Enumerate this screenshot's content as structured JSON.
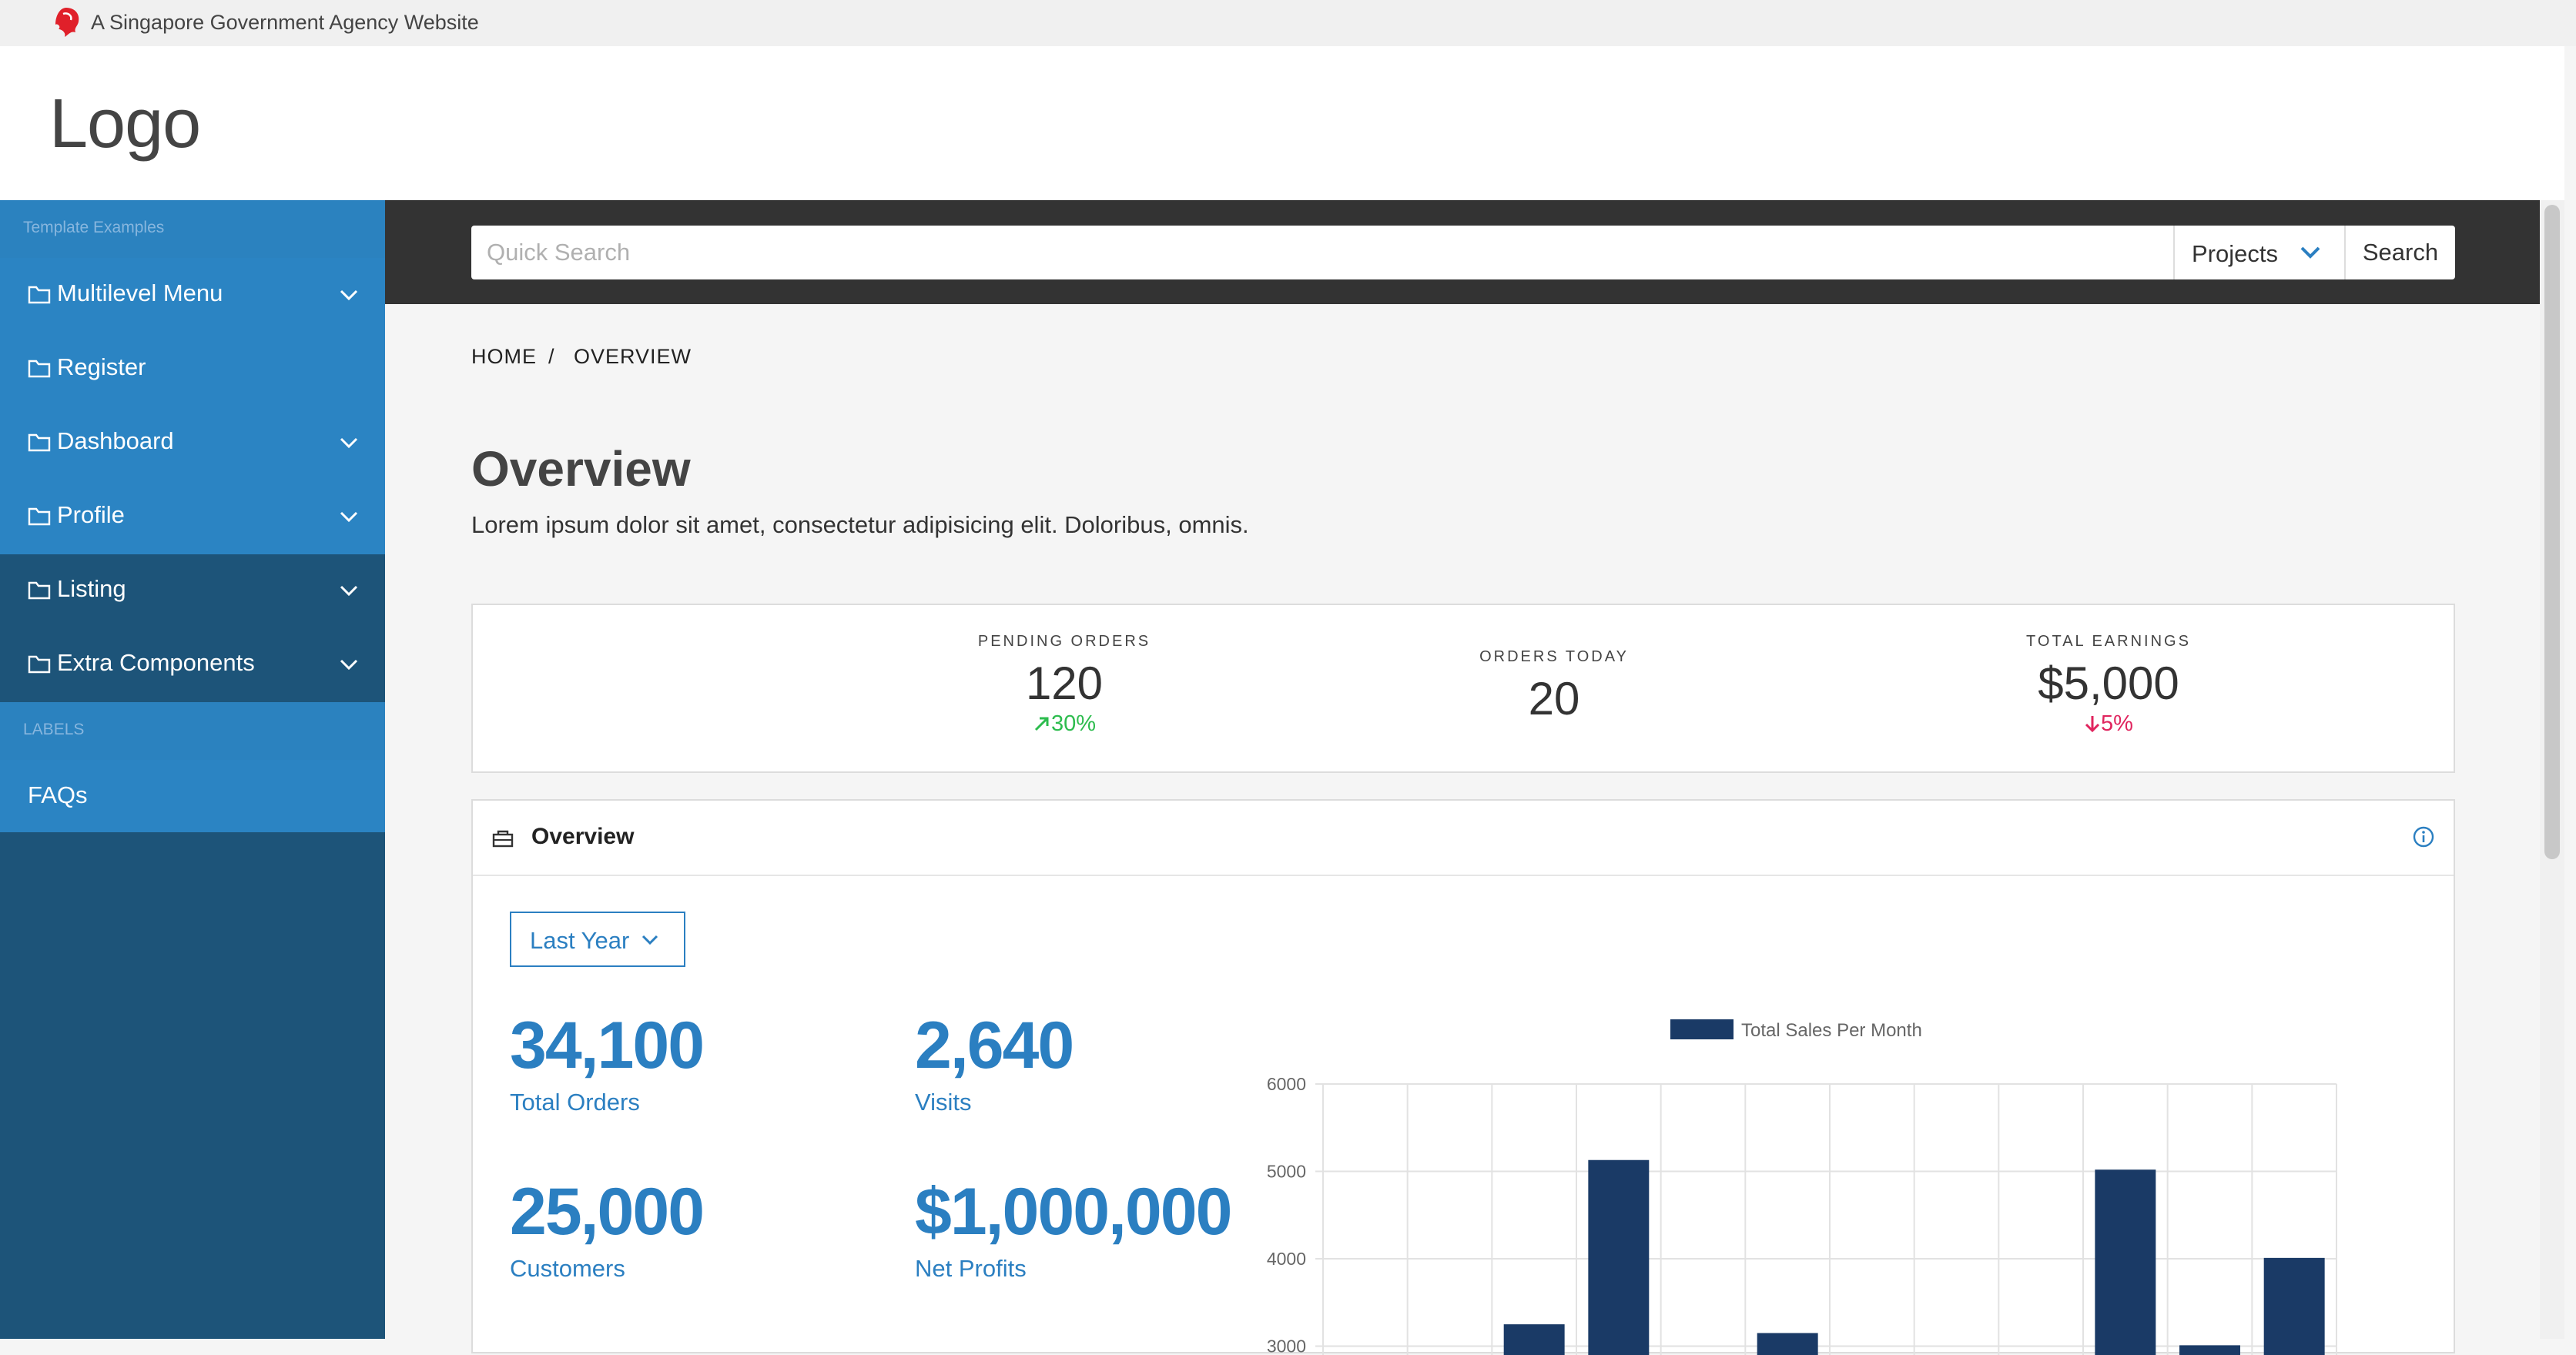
{
  "masthead": {
    "text": "A Singapore Government Agency Website"
  },
  "header": {
    "logo": "Logo"
  },
  "sidebar": {
    "section1": "Template Examples",
    "items": [
      {
        "label": "Multilevel Menu",
        "expandable": true
      },
      {
        "label": "Register",
        "expandable": false
      },
      {
        "label": "Dashboard",
        "expandable": true
      },
      {
        "label": "Profile",
        "expandable": true
      },
      {
        "label": "Listing",
        "expandable": true
      },
      {
        "label": "Extra Components",
        "expandable": true
      }
    ],
    "section2": "LABELS",
    "faq": "FAQs"
  },
  "search": {
    "placeholder": "Quick Search",
    "category": "Projects",
    "button": "Search"
  },
  "breadcrumb": {
    "home": "HOME",
    "sep": "/",
    "current": "OVERVIEW"
  },
  "page": {
    "title": "Overview",
    "subtitle": "Lorem ipsum dolor sit amet, consectetur adipisicing elit. Doloribus, omnis."
  },
  "stats": {
    "pending": {
      "label": "PENDING ORDERS",
      "value": "120",
      "change": "30%"
    },
    "today": {
      "label": "ORDERS TODAY",
      "value": "20"
    },
    "earnings": {
      "label": "TOTAL EARNINGS",
      "value": "$5,000",
      "change": "5%"
    }
  },
  "card": {
    "title": "Overview",
    "period": "Last Year",
    "metrics": [
      {
        "value": "34,100",
        "label": "Total Orders"
      },
      {
        "value": "2,640",
        "label": "Visits"
      },
      {
        "value": "25,000",
        "label": "Customers"
      },
      {
        "value": "$1,000,000",
        "label": "Net Profits"
      }
    ]
  },
  "colors": {
    "accent": "#2b7fc1",
    "sidebar": "#1d5479",
    "sidebar_active": "#2b84c3",
    "bar": "#1a3a66",
    "up": "#2dbc4e",
    "down": "#e0245e"
  },
  "chart_data": {
    "type": "bar",
    "legend": "Total Sales Per Month",
    "legend_position": "top",
    "grid": true,
    "y_ticks": [
      "6000",
      "5000",
      "4000",
      "3000"
    ],
    "ylim_visible": [
      2700,
      6000
    ],
    "slots": 12,
    "values": [
      null,
      null,
      3250,
      5130,
      null,
      3150,
      null,
      null,
      null,
      5020,
      3010,
      4010
    ]
  }
}
